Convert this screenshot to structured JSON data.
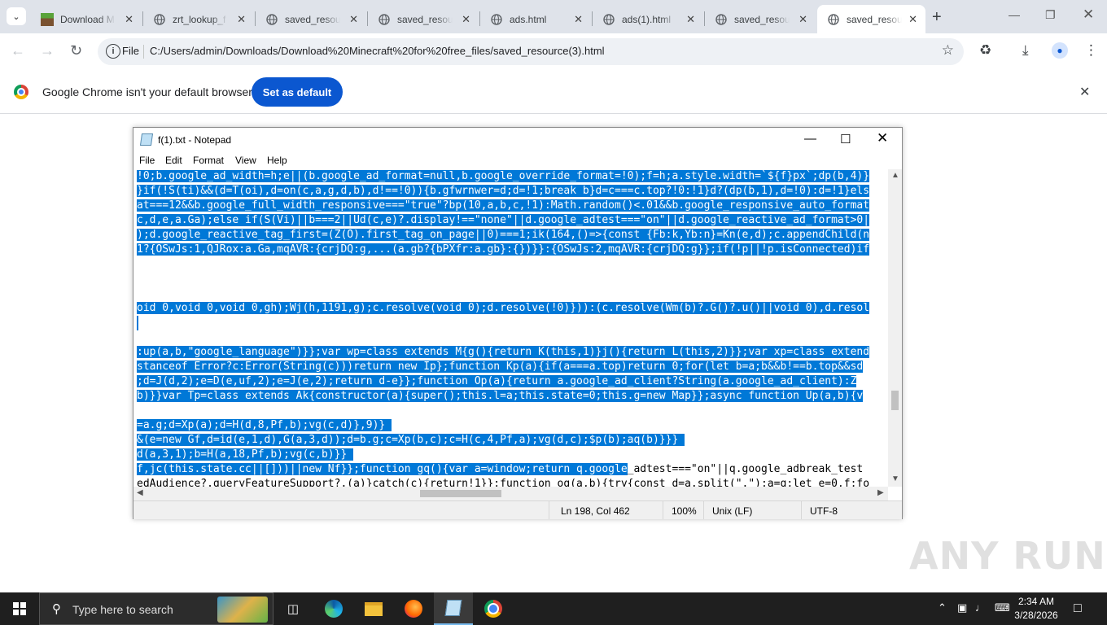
{
  "browser": {
    "tabs": [
      {
        "title": "Download M",
        "icon": "minecraft-icon",
        "active": false
      },
      {
        "title": "zrt_lookup_f",
        "icon": "globe-icon",
        "active": false
      },
      {
        "title": "saved_resou",
        "icon": "globe-icon",
        "active": false
      },
      {
        "title": "saved_resou",
        "icon": "globe-icon",
        "active": false
      },
      {
        "title": "ads.html",
        "icon": "globe-icon",
        "active": false
      },
      {
        "title": "ads(1).html",
        "icon": "globe-icon",
        "active": false
      },
      {
        "title": "saved_resou",
        "icon": "globe-icon",
        "active": false
      },
      {
        "title": "saved_resou",
        "icon": "globe-icon",
        "active": true
      }
    ],
    "omnibox": {
      "scheme_label": "File",
      "url": "C:/Users/admin/Downloads/Download%20Minecraft%20for%20free_files/saved_resource(3).html"
    },
    "infobar": {
      "message": "Google Chrome isn't your default browser",
      "button_label": "Set as default"
    }
  },
  "notepad": {
    "title": "f(1).txt - Notepad",
    "menu": [
      "File",
      "Edit",
      "Format",
      "View",
      "Help"
    ],
    "lines": [
      {
        "text": "!0;b.google_ad_width=h;e||(b.google_ad_format=null,b.google_override_format=!0);f=h;a.style.width=`${f}px`;dp(b,4)}",
        "selected": true
      },
      {
        "text": "}if(!S(ti)&&(d=T(oi),d=on(c,a,g,d,b),d!==!0)){b.gfwrnwer=d;d=!1;break b}d=c===c.top?!0:!1}d?(dp(b,1),d=!0):d=!1}els",
        "selected": true
      },
      {
        "text": "at===12&&b.google_full_width_responsive===\"true\"?bp(10,a,b,c,!1):Math.random()<.01&&b.google_responsive_auto_format",
        "selected": true
      },
      {
        "text": "c,d,e,a.Ga);else if(S(Vi)||b===2||Ud(c,e)?.display!==\"none\"||d.google_adtest===\"on\"||d.google_reactive_ad_format>0|",
        "selected": true
      },
      {
        "text": ");d.google_reactive_tag_first=(Z(O).first_tag_on_page||0)===1;ik(164,()=>{const {Fb:k,Yb:n}=Kn(e,d);c.appendChild(n",
        "selected": true
      },
      {
        "text": "1?{OSwJs:1,QJRox:a.Ga,mqAVR:{crjDQ:g,...(a.gb?{bPXfr:a.gb}:{})}}:{OSwJs:2,mqAVR:{crjDQ:g}};if(!p||!p.isConnected)if",
        "selected": true
      },
      {
        "text": "",
        "selected": false
      },
      {
        "text": "",
        "selected": false
      },
      {
        "text": "",
        "selected": false
      },
      {
        "text": "oid 0,void 0,void 0,gh);Wj(h,1191,g);c.resolve(void 0);d.resolve(!0)})):(c.resolve(Wm(b)?.G()?.u()||void 0),d.resol",
        "selected": true
      },
      {
        "text": "",
        "selected": false
      },
      {
        "text": "",
        "selected": false
      },
      {
        "text": ":up(a,b,\"google_language\")}};var wp=class extends M{g(){return K(this,1)}j(){return L(this,2)}};var xp=class extend",
        "selected": true
      },
      {
        "text": "stanceof Error?c:Error(String(c)))return new Ip};function Kp(a){if(a===a.top)return 0;for(let b=a;b&&b!==b.top&&sd",
        "selected": true
      },
      {
        "text": ";d=J(d,2);e=D(e,uf,2);e=J(e,2);return d-e}};function Op(a){return a.google_ad_client?String(a.google_ad_client):Z",
        "selected": true
      },
      {
        "text": "b)}}var Tp=class extends Ak{constructor(a){super();this.l=a;this.state=0;this.g=new Map}};async function Up(a,b){v",
        "selected": true
      },
      {
        "text": "",
        "selected": false
      },
      {
        "text": "=a.g;d=Xp(a);d=H(d,8,Pf,b);vg(c,d)},9)} ",
        "selected": true
      },
      {
        "text": "&(e=new Gf,d=id(e,1,d),G(a,3,d));d=b.g;c=Xp(b,c);c=H(c,4,Pf,a);vg(d,c);$p(b);aq(b)}}} ",
        "selected": true
      },
      {
        "text": "d(a,3,1);b=H(a,18,Pf,b);vg(c,b)}} ",
        "selected": true
      },
      {
        "text": "f,jc(this.state.cc||[]))||new Nf}};function gq(){var a=window;return q.google",
        "selected": true,
        "rest": "_adtest===\"on\"||q.google_adbreak_test"
      },
      {
        "text": "",
        "selected": false,
        "rest": "edAudience?.queryFeatureSupport?.(a)}catch(c){return!1}};function og(a,b){try{const d=a.split(\".\");a=q;let e=0,f;fo"
      }
    ],
    "status": {
      "position": "Ln 198, Col 462",
      "zoom": "100%",
      "line_ending": "Unix (LF)",
      "encoding": "UTF-8"
    }
  },
  "watermark": "ANY RUN",
  "taskbar": {
    "search_placeholder": "Type here to search",
    "apps": [
      "task-view",
      "edge",
      "file-explorer",
      "firefox",
      "notepad",
      "chrome"
    ],
    "clock": {
      "time": "2:34 AM",
      "date": "3/28/2026"
    }
  }
}
